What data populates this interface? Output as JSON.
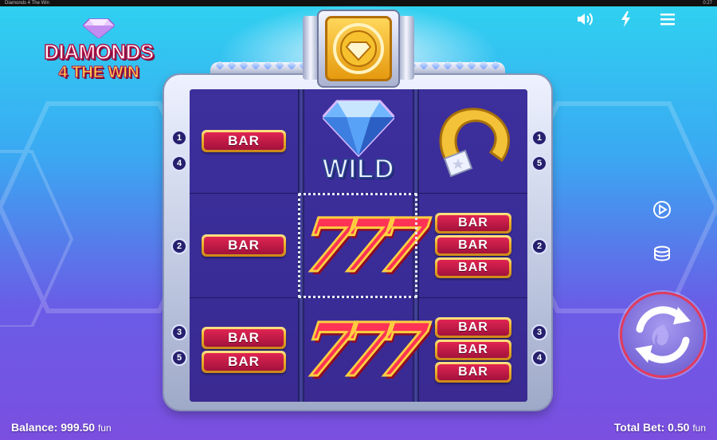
{
  "window": {
    "title": "Diamonds 4 The Win",
    "clock": "0:27"
  },
  "logo": {
    "line1": "DIAMONDS",
    "line2": "4 THE WIN"
  },
  "colors": {
    "accent": "#e02452",
    "gold": "#f0b429",
    "reel_bg": "#3a2d98",
    "spin_ring": "#e23b5d"
  },
  "top_icons": [
    "speaker-icon",
    "lightning-icon",
    "menu-icon"
  ],
  "side_icons": [
    "autoplay-icon",
    "coins-stack-icon"
  ],
  "reels": {
    "col1": [
      "BAR",
      "BAR",
      "BAR BAR"
    ],
    "col2": [
      "WILD",
      "777",
      "777"
    ],
    "col3": [
      "horseshoe",
      "BAR BAR BAR",
      "BAR BAR BAR"
    ]
  },
  "symbols": {
    "bar": "BAR",
    "wild": "WILD",
    "seven": "777"
  },
  "paylines": {
    "left": [
      "1",
      "4",
      "2",
      "3",
      "5"
    ],
    "right": [
      "1",
      "5",
      "2",
      "3",
      "4"
    ]
  },
  "footer": {
    "balance_label": "Balance:",
    "balance_value": "999.50",
    "balance_unit": "fun",
    "bet_label": "Total Bet:",
    "bet_value": "0.50",
    "bet_unit": "fun"
  }
}
